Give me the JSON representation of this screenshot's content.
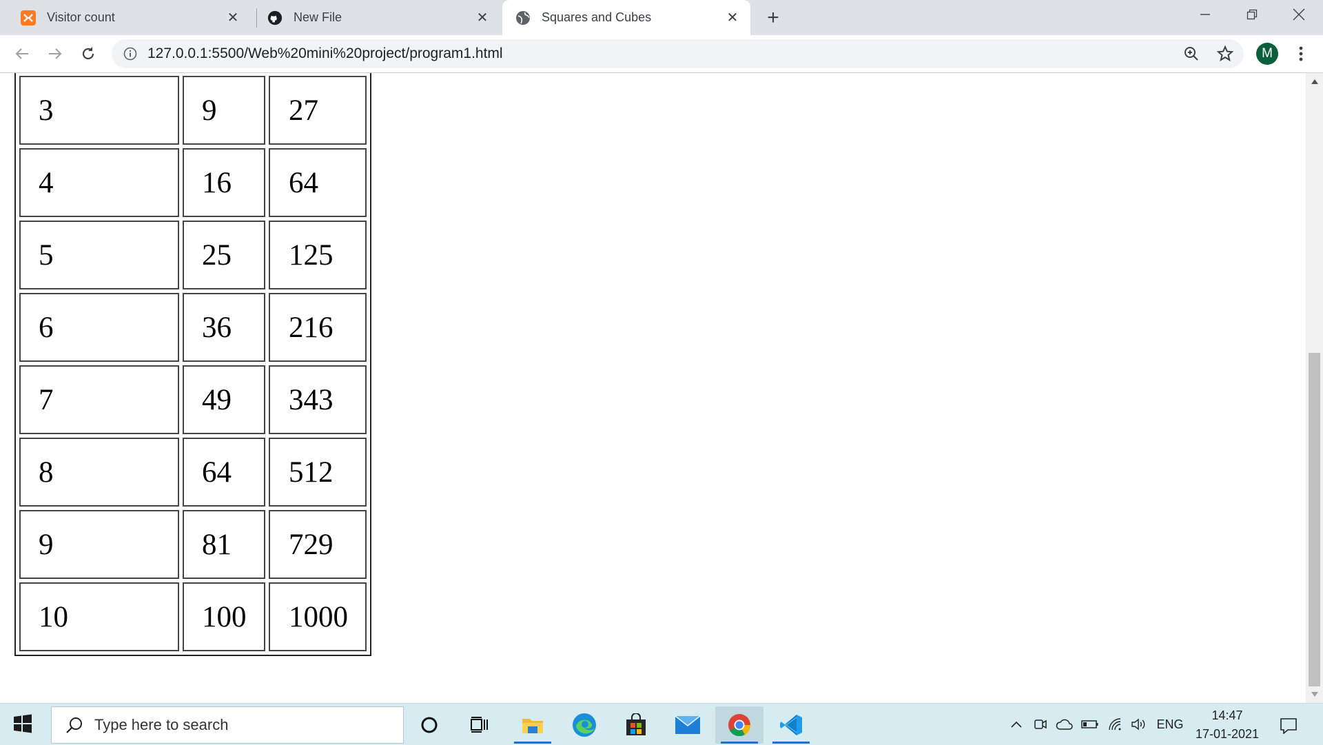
{
  "browser": {
    "tabs": [
      {
        "title": "Visitor count",
        "icon": "xampp-icon",
        "active": false
      },
      {
        "title": "New File",
        "icon": "github-icon",
        "active": false
      },
      {
        "title": "Squares and Cubes",
        "icon": "globe-icon",
        "active": true
      }
    ],
    "url": "127.0.0.1:5500/Web%20mini%20project/program1.html",
    "avatar_letter": "M"
  },
  "page": {
    "table_rows": [
      [
        "3",
        "9",
        "27"
      ],
      [
        "4",
        "16",
        "64"
      ],
      [
        "5",
        "25",
        "125"
      ],
      [
        "6",
        "36",
        "216"
      ],
      [
        "7",
        "49",
        "343"
      ],
      [
        "8",
        "64",
        "512"
      ],
      [
        "9",
        "81",
        "729"
      ],
      [
        "10",
        "100",
        "1000"
      ]
    ]
  },
  "taskbar": {
    "search_placeholder": "Type here to search",
    "apps": [
      "cortana-icon",
      "task-view-icon",
      "file-explorer-icon",
      "edge-icon",
      "store-icon",
      "mail-icon",
      "chrome-icon",
      "vscode-icon"
    ],
    "language": "ENG",
    "time": "14:47",
    "date": "17-01-2021"
  },
  "colors": {
    "tab_strip": "#dee1e6",
    "taskbar": "#d6ecf0",
    "avatar": "#0b5f3a",
    "accent_blue": "#1e73c9"
  }
}
